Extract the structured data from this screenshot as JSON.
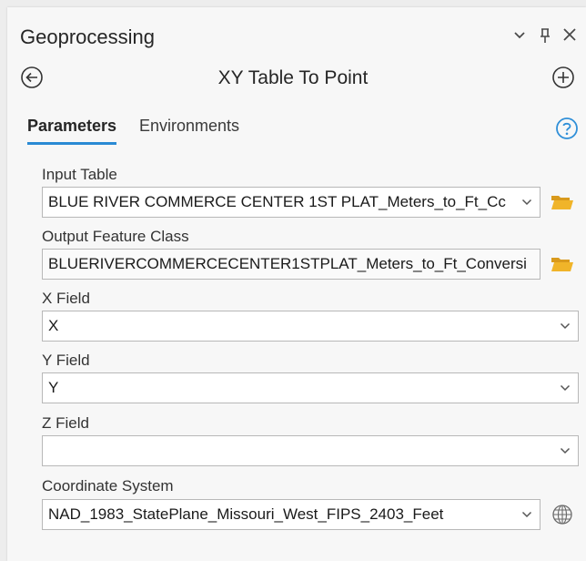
{
  "pane": {
    "title": "Geoprocessing",
    "icons": [
      "chevron-down-icon",
      "pin-icon",
      "close-icon"
    ]
  },
  "tool": {
    "title": "XY Table To Point",
    "back_icon": "back-circle-icon",
    "add_icon": "add-circle-icon"
  },
  "tabs": [
    {
      "label": "Parameters",
      "active": true
    },
    {
      "label": "Environments",
      "active": false
    }
  ],
  "help_icon": "help-icon",
  "params": {
    "input_table": {
      "label": "Input Table",
      "value": "BLUE RIVER COMMERCE CENTER 1ST PLAT_Meters_to_Ft_Cc"
    },
    "output_feature_class": {
      "label": "Output Feature Class",
      "value": "BLUERIVERCOMMERCECENTER1STPLAT_Meters_to_Ft_Conversi"
    },
    "x_field": {
      "label": "X Field",
      "value": "X"
    },
    "y_field": {
      "label": "Y Field",
      "value": "Y"
    },
    "z_field": {
      "label": "Z Field",
      "value": ""
    },
    "coordinate_system": {
      "label": "Coordinate System",
      "value": "NAD_1983_StatePlane_Missouri_West_FIPS_2403_Feet"
    }
  },
  "colors": {
    "accent": "#2a8ad4",
    "folder": "#f0b429",
    "help": "#2f8fd8"
  }
}
